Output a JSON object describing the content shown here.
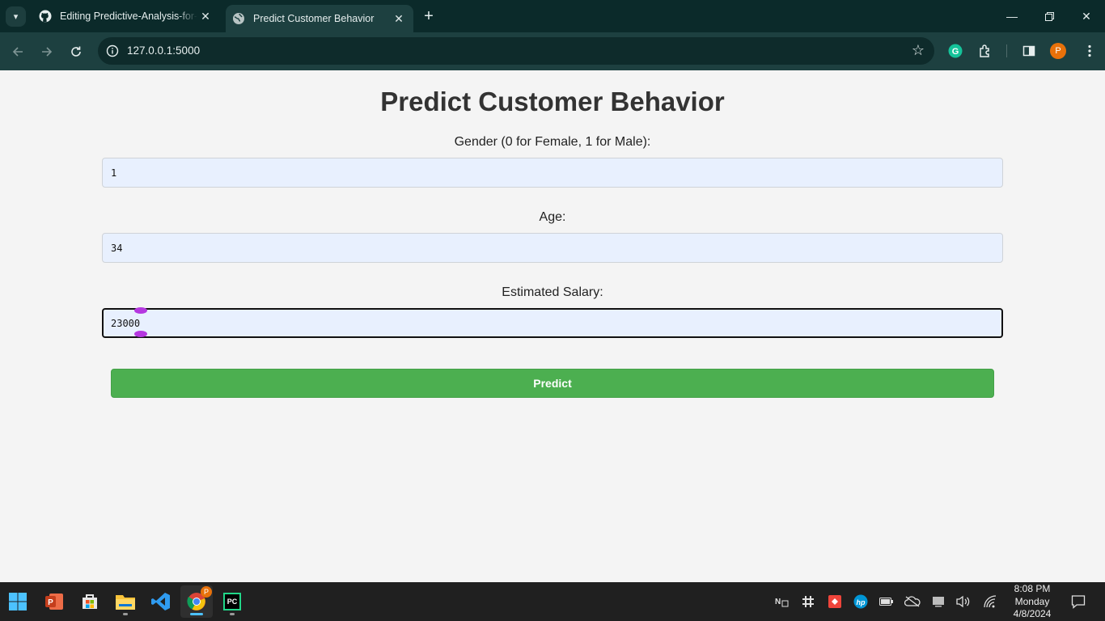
{
  "browser": {
    "tabs": [
      {
        "title": "Editing Predictive-Analysis-for-",
        "favicon": "github-icon",
        "active": false
      },
      {
        "title": "Predict Customer Behavior",
        "favicon": "globe-icon",
        "active": true
      }
    ],
    "url": "127.0.0.1:5000",
    "profile_initial": "P"
  },
  "page": {
    "heading": "Predict Customer Behavior",
    "fields": [
      {
        "label": "Gender (0 for Female, 1 for Male):",
        "value": "1"
      },
      {
        "label": "Age:",
        "value": "34"
      },
      {
        "label": "Estimated Salary:",
        "value": "23000"
      }
    ],
    "submit_label": "Predict",
    "colors": {
      "button": "#4caf50",
      "input_bg": "#e8f0fe",
      "heading": "#333333"
    }
  },
  "taskbar": {
    "apps": [
      "start-icon",
      "powerpoint-icon",
      "store-icon",
      "file-explorer-icon",
      "vscode-icon",
      "chrome-icon",
      "pycharm-icon"
    ],
    "pycharm_label": "PC",
    "chrome_badge": "P",
    "time": "8:08 PM",
    "day": "Monday",
    "date": "4/8/2024"
  }
}
